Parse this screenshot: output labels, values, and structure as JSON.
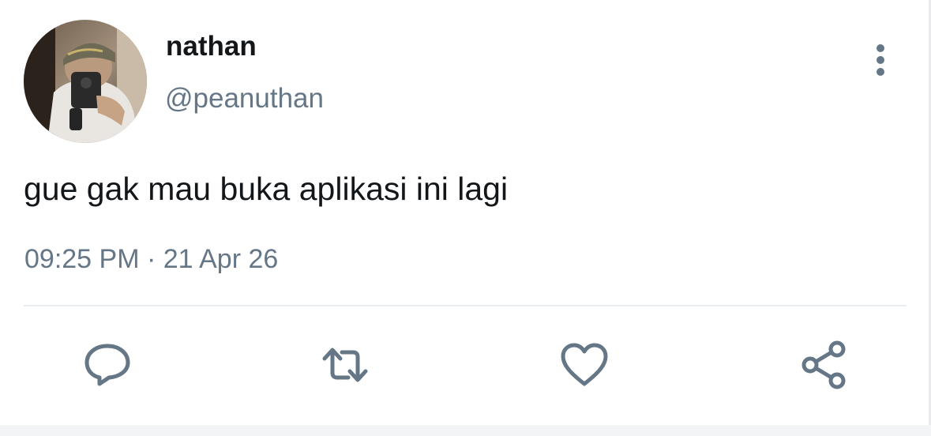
{
  "tweet": {
    "author": {
      "display_name": "nathan",
      "handle": "@peanuthan",
      "avatar": "profile-photo"
    },
    "text": "gue gak mau buka aplikasi ini lagi",
    "timestamp": "09:25 PM · 21 Apr 26"
  },
  "menu": {
    "icon": "more-vertical-icon"
  },
  "actions": [
    {
      "name": "reply",
      "icon": "comment-icon"
    },
    {
      "name": "retweet",
      "icon": "retweet-icon"
    },
    {
      "name": "like",
      "icon": "heart-icon"
    },
    {
      "name": "share",
      "icon": "share-icon"
    }
  ],
  "colors": {
    "primary_text": "#14171a",
    "secondary_text": "#657786",
    "icon": "#657786",
    "divider": "#e6ecf0",
    "background": "#ffffff"
  }
}
